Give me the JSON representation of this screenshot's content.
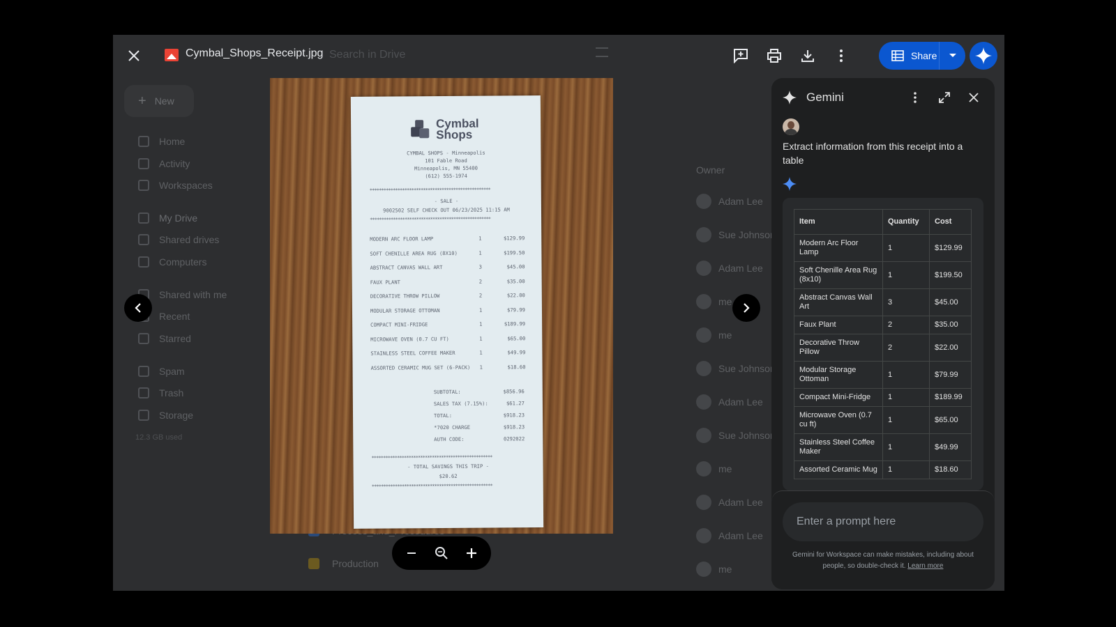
{
  "header": {
    "file_name": "Cymbal_Shops_Receipt.jpg",
    "search_placeholder": "Search in Drive",
    "share_label": "Share",
    "icons": [
      "close-icon",
      "add-comment-icon",
      "print-icon",
      "download-icon",
      "more-vert-icon",
      "arrow-drop-down-icon",
      "gemini-spark-icon"
    ]
  },
  "background_drive": {
    "new_label": "New",
    "nav": [
      "Home",
      "Activity",
      "Workspaces",
      "My Drive",
      "Shared drives",
      "Computers",
      "Shared with me",
      "Recent",
      "Starred",
      "Spam",
      "Trash",
      "Storage"
    ],
    "storage_used": "12.3 GB used",
    "owner_header": "Owner",
    "owners": [
      "Adam Lee",
      "Sue Johnson",
      "Adam Lee",
      "me",
      "me",
      "Sue Johnson",
      "Adam Lee",
      "Sue Johnson",
      "me",
      "Adam Lee",
      "Adam Lee",
      "me"
    ],
    "files": [
      "Process_and_Procedures",
      "Production"
    ]
  },
  "receipt": {
    "brand_line1": "Cymbal",
    "brand_line2": "Shops",
    "store_lines": [
      "CYMBAL SHOPS - Minneapolis",
      "101 Fable Road",
      "Minneapolis, MN 55400",
      "(612) 555-1974"
    ],
    "stars": "****************************************************",
    "sale_label": "- SALE -",
    "transaction": "9002502 SELF CHECK OUT 06/23/2025 11:15 AM",
    "items": [
      {
        "name": "MODERN ARC FLOOR LAMP",
        "qty": "1",
        "price": "$129.99"
      },
      {
        "name": "SOFT CHENILLE AREA RUG (8X10)",
        "qty": "1",
        "price": "$199.50"
      },
      {
        "name": "ABSTRACT CANVAS WALL ART",
        "qty": "3",
        "price": "$45.00"
      },
      {
        "name": "FAUX PLANT",
        "qty": "2",
        "price": "$35.00"
      },
      {
        "name": "DECORATIVE THROW PILLOW",
        "qty": "2",
        "price": "$22.00"
      },
      {
        "name": "MODULAR STORAGE OTTOMAN",
        "qty": "1",
        "price": "$79.99"
      },
      {
        "name": "COMPACT MINI-FRIDGE",
        "qty": "1",
        "price": "$189.99"
      },
      {
        "name": "MICROWAVE OVEN (0.7 CU FT)",
        "qty": "1",
        "price": "$65.00"
      },
      {
        "name": "STAINLESS STEEL COFFEE MAKER",
        "qty": "1",
        "price": "$49.99"
      },
      {
        "name": "ASSORTED CERAMIC MUG SET (6-PACK)",
        "qty": "1",
        "price": "$18.60"
      }
    ],
    "totals": [
      {
        "label": "SUBTOTAL:",
        "value": "$856.96"
      },
      {
        "label": "SALES TAX (7.15%):",
        "value": "$61.27"
      },
      {
        "label": "TOTAL:",
        "value": "$918.23"
      },
      {
        "label": "*7020 CHARGE",
        "value": "$918.23"
      },
      {
        "label": "AUTH CODE:",
        "value": "0292022"
      }
    ],
    "savings_label": "- TOTAL SAVINGS THIS TRIP -",
    "savings_value": "$20.62"
  },
  "gemini": {
    "title": "Gemini",
    "user_prompt": "Extract information from this receipt into a table",
    "table_headers": [
      "Item",
      "Quantity",
      "Cost"
    ],
    "table_rows": [
      [
        "Modern Arc Floor Lamp",
        "1",
        "$129.99"
      ],
      [
        "Soft Chenille Area Rug (8x10)",
        "1",
        "$199.50"
      ],
      [
        "Abstract Canvas Wall Art",
        "3",
        "$45.00"
      ],
      [
        "Faux Plant",
        "2",
        "$35.00"
      ],
      [
        "Decorative Throw Pillow",
        "2",
        "$22.00"
      ],
      [
        "Modular Storage Ottoman",
        "1",
        "$79.99"
      ],
      [
        "Compact Mini-Fridge",
        "1",
        "$189.99"
      ],
      [
        "Microwave Oven (0.7 cu ft)",
        "1",
        "$65.00"
      ],
      [
        "Stainless Steel Coffee Maker",
        "1",
        "$49.99"
      ],
      [
        "Assorted Ceramic Mug",
        "1",
        "$18.60"
      ]
    ],
    "input_placeholder": "Enter a prompt here",
    "disclaimer": "Gemini for Workspace can make mistakes, including about people, so double-check it.",
    "learn_more": "Learn more",
    "accent_color": "#0b57d0",
    "spark_color": "#4c8df6"
  }
}
